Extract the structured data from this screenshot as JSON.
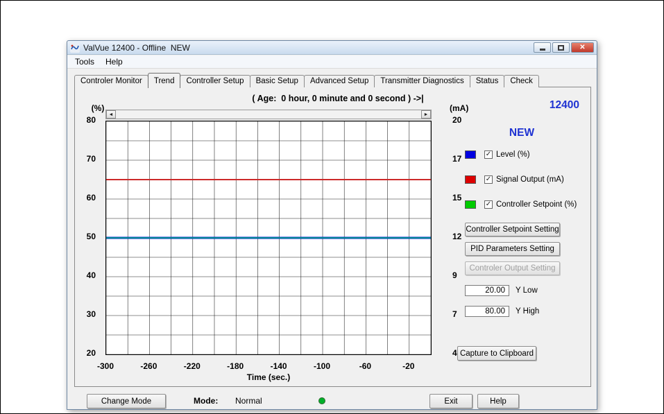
{
  "window": {
    "title": "ValVue 12400 - Offline  NEW",
    "menu": [
      "Tools",
      "Help"
    ]
  },
  "tabs": {
    "items": [
      "Controler Monitor",
      "Trend",
      "Controller Setup",
      "Basic Setup",
      "Advanced Setup",
      "Transmitter Diagnostics",
      "Status",
      "Check"
    ],
    "selected": "Trend"
  },
  "trend": {
    "age_text": "( Age:  0 hour, 0 minute and 0 second ) ->|",
    "device_id": "12400",
    "device_tag": "NEW",
    "legend": [
      {
        "label": "Level (%)",
        "color": "#0000e0",
        "checked": true
      },
      {
        "label": "Signal Output (mA)",
        "color": "#dd0000",
        "checked": true
      },
      {
        "label": "Controller Setpoint (%)",
        "color": "#00cc00",
        "checked": true
      }
    ],
    "buttons": {
      "setpoint_setting": "Controller Setpoint Setting",
      "pid_setting": "PID Parameters Setting",
      "output_setting": "Controler Output Setting",
      "output_setting_disabled": true,
      "capture": "Capture to Clipboard"
    },
    "y_low": {
      "value": "20.00",
      "label": "Y Low"
    },
    "y_high": {
      "value": "80.00",
      "label": "Y High"
    }
  },
  "chart_data": {
    "type": "line",
    "title": "( Age:  0 hour, 0 minute and 0 second ) ->|",
    "xlabel": "Time (sec.)",
    "ylabel_left": "(%)",
    "ylabel_right": "(mA)",
    "xlim": [
      -300,
      0
    ],
    "ylim_left": [
      20,
      80
    ],
    "ylim_right": [
      4,
      20
    ],
    "x_tick_values": [
      -300,
      -260,
      -220,
      -180,
      -140,
      -100,
      -60,
      -20
    ],
    "x_tick_labels": [
      "-300",
      "-260",
      "-220",
      "-180",
      "-140",
      "-100",
      "-60",
      "-20"
    ],
    "y_tick_labels_left": [
      "80",
      "70",
      "60",
      "50",
      "40",
      "30",
      "20"
    ],
    "y_tick_labels_right": [
      "20",
      "17",
      "15",
      "12",
      "9",
      "7",
      "4"
    ],
    "grid": {
      "x_step": 20,
      "y_step": 5,
      "on": true
    },
    "legend_position": "right",
    "series": [
      {
        "name": "Level (%)",
        "color": "#0018d8",
        "value_pct": 50,
        "width": 3
      },
      {
        "name": "Controller Setpoint (%)",
        "color": "#009688",
        "value_pct": 50,
        "width": 1.8
      },
      {
        "name": "Signal Output (mA)",
        "color": "#cc2a2a",
        "value_pct": 65,
        "value_ma": 16,
        "width": 2
      }
    ]
  },
  "footer": {
    "change_mode": "Change Mode",
    "mode_label": "Mode:",
    "mode_value": "Normal",
    "exit": "Exit",
    "help": "Help",
    "indicator_color": "#00b02a"
  },
  "colors": {
    "accent_blue": "#1e32d2"
  },
  "icons": {
    "check": "✓",
    "scroll_left": "◄",
    "scroll_right": "►",
    "close": "✕"
  }
}
